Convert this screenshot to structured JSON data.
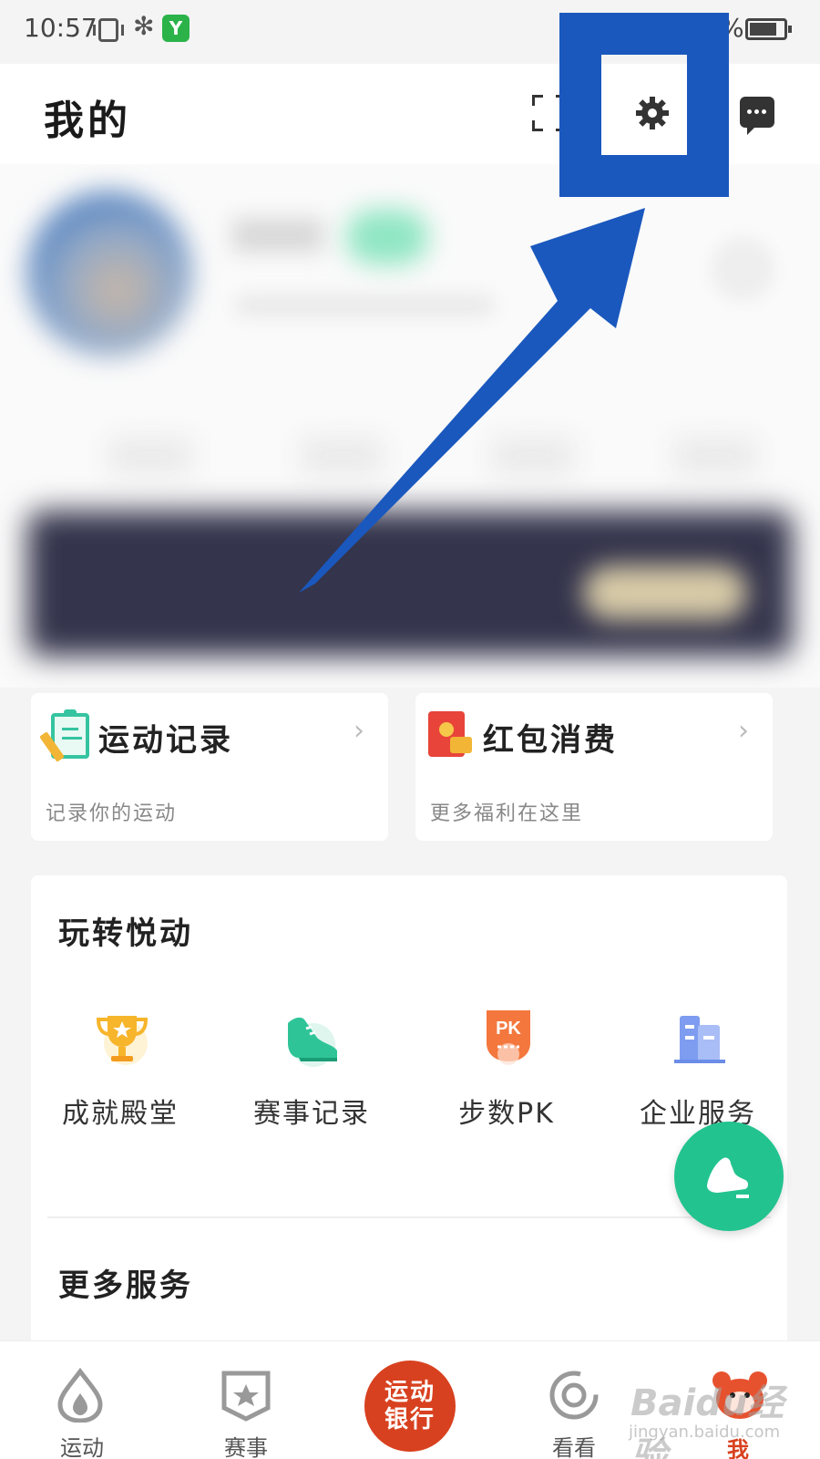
{
  "status_bar": {
    "time": "10:57",
    "bluetooth_icon": "bluetooth-icon",
    "app_icon_text": "Y",
    "battery_text": "%",
    "battery_level_percent": 80
  },
  "header": {
    "title": "我的",
    "icons": [
      "scan-icon",
      "gear-icon",
      "message-icon"
    ]
  },
  "quick_cards": [
    {
      "title": "运动记录",
      "subtitle": "记录你的运动",
      "icon": "clipboard-icon"
    },
    {
      "title": "红包消费",
      "subtitle": "更多福利在这里",
      "icon": "red-packet-icon"
    }
  ],
  "play_section": {
    "title": "玩转悦动",
    "items": [
      {
        "label": "成就殿堂",
        "icon": "trophy-icon"
      },
      {
        "label": "赛事记录",
        "icon": "shoe-icon"
      },
      {
        "label": "步数PK",
        "icon": "pk-icon"
      },
      {
        "label": "企业服务",
        "icon": "building-icon"
      }
    ]
  },
  "more_section": {
    "title": "更多服务"
  },
  "bottom_nav": {
    "items": [
      {
        "label": "运动",
        "icon": "drop-icon"
      },
      {
        "label": "赛事",
        "icon": "badge-star-icon"
      },
      {
        "label": "运动银行",
        "icon": "center-bank-button"
      },
      {
        "label": "看看",
        "icon": "circle-icon"
      },
      {
        "label": "我",
        "icon": "bear-icon"
      }
    ],
    "center_line1": "运动",
    "center_line2": "银行",
    "active": "我"
  },
  "watermark": {
    "main": "Baidu经验",
    "sub": "jingyan.baidu.com"
  },
  "colors": {
    "accent_green": "#22c38e",
    "annotation_blue": "#1a58be",
    "center_red": "#d8411f"
  }
}
